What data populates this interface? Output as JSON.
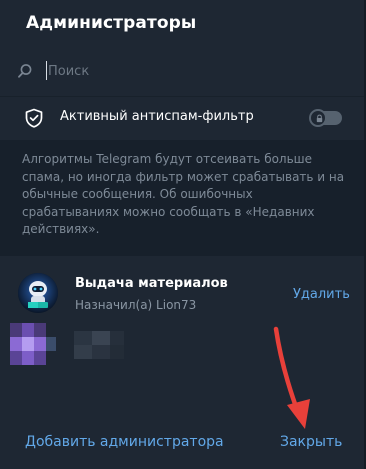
{
  "dialog": {
    "title": "Администраторы"
  },
  "search": {
    "placeholder": "Поиск",
    "icon": "search-icon"
  },
  "antispam": {
    "label": "Активный антиспам-фильтр",
    "icon": "shield-icon",
    "toggle_on": false,
    "toggle_icon": "lock-icon",
    "description": "Алгоритмы Telegram будут отсеивать больше спама, но иногда фильтр может срабатывать и на обычные сообщения. Об ошибочных срабатываниях можно сообщать в «Недавних действиях»."
  },
  "admins": [
    {
      "name": "Выдача материалов",
      "subtitle": "Назначил(а) Lion73",
      "action": "Удалить",
      "avatar": "robot-avatar"
    }
  ],
  "footer": {
    "add_admin": "Добавить администратора",
    "close": "Закрыть"
  },
  "colors": {
    "background": "#1e2733",
    "info_background": "#17202b",
    "accent": "#62a8e8",
    "annotation_arrow": "#e8403a"
  }
}
